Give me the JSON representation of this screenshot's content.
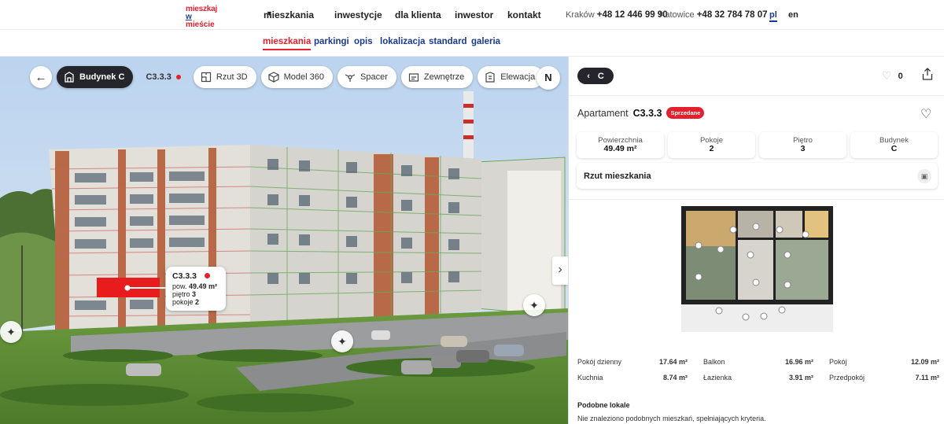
{
  "brand": {
    "line1": "mieszkaj",
    "line2a": "w",
    "line2b": " mieście"
  },
  "nav": {
    "items": [
      "mieszkania",
      "inwestycje",
      "dla klienta",
      "inwestor",
      "kontakt"
    ],
    "phone1_city": "Kraków",
    "phone1_num": "+48 12 446 99 90",
    "phone2_city": "Katowice",
    "phone2_num": "+48 32 784 78 07",
    "lang_pl": "pl",
    "lang_en": "en"
  },
  "subnav": [
    "mieszkania",
    "parkingi",
    "opis",
    "lokalizacja",
    "standard",
    "galeria"
  ],
  "toolbar": {
    "building": "Budynek C",
    "code": "C3.3.3",
    "rzut3d": "Rzut 3D",
    "model360": "Model 360",
    "spacer": "Spacer",
    "zewnetrze": "Zewnętrze",
    "elewacja": "Elewacja",
    "compass": "N"
  },
  "popup": {
    "code": "C3.3.3",
    "pow_label": "pow.",
    "pow_value": "49.49 m²",
    "pietro_label": "piętro",
    "pietro_value": "3",
    "pokoje_label": "pokoje",
    "pokoje_value": "2"
  },
  "panel": {
    "back_label": "C",
    "fav_count": "0",
    "apt_label": "Apartament",
    "apt_code": "C3.3.3",
    "status": "Sprzedane",
    "stats": [
      {
        "label": "Powierzchnia",
        "value": "49.49 m²"
      },
      {
        "label": "Pokoje",
        "value": "2"
      },
      {
        "label": "Piętro",
        "value": "3"
      },
      {
        "label": "Budynek",
        "value": "C"
      }
    ],
    "rzut_label": "Rzut mieszkania",
    "rooms": [
      {
        "name": "Pokój dzienny",
        "area": "17.64 m²"
      },
      {
        "name": "Balkon",
        "area": "16.96 m²"
      },
      {
        "name": "Pokój",
        "area": "12.09 m²"
      },
      {
        "name": "Kuchnia",
        "area": "8.74 m²"
      },
      {
        "name": "Łazienka",
        "area": "3.91 m²"
      },
      {
        "name": "Przedpokój",
        "area": "7.11 m²"
      }
    ],
    "similar_title": "Podobne lokale",
    "similar_desc": "Nie znaleziono podobnych mieszkań, spełniających kryteria."
  },
  "colors": {
    "accent_red": "#e4202c",
    "brand_blue": "#1a3a8f",
    "dark": "#24262b"
  }
}
